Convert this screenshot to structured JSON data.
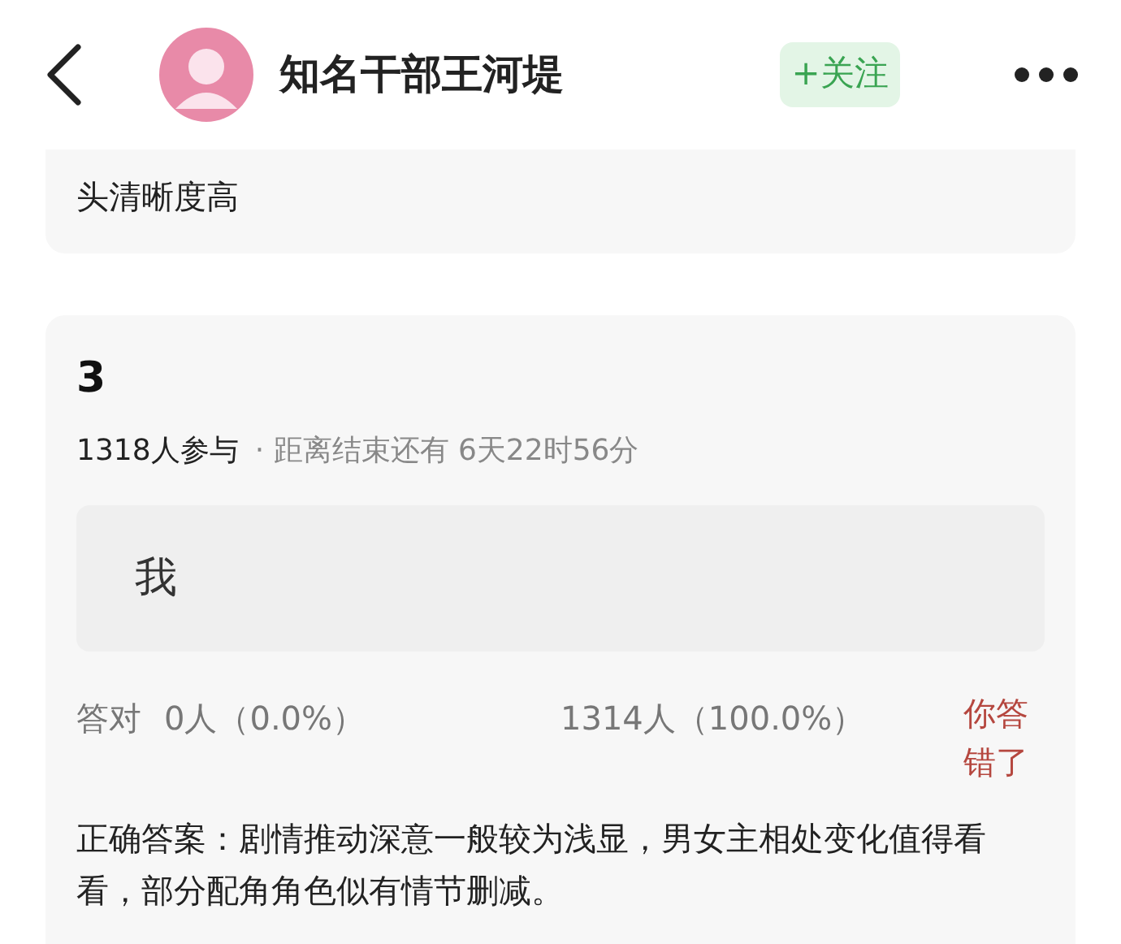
{
  "header": {
    "name": "知名干部王河堤",
    "follow_button": "+关注"
  },
  "previous_card": {
    "answer_tail": "头清晰度高"
  },
  "question": {
    "number": "3",
    "participants": "1318人参与",
    "countdown": "· 距离结束还有 6天22时56分",
    "option": {
      "text": "我"
    },
    "stats": {
      "correct_label": "答对",
      "correct_count": "0人（0.0%）",
      "other_count": "1314人（100.0%）",
      "result": "你答错了"
    },
    "answer": "正确答案：剧情推动深意一般较为浅显，男女主相处变化值得看看，部分配角角色似有情节删减。"
  }
}
